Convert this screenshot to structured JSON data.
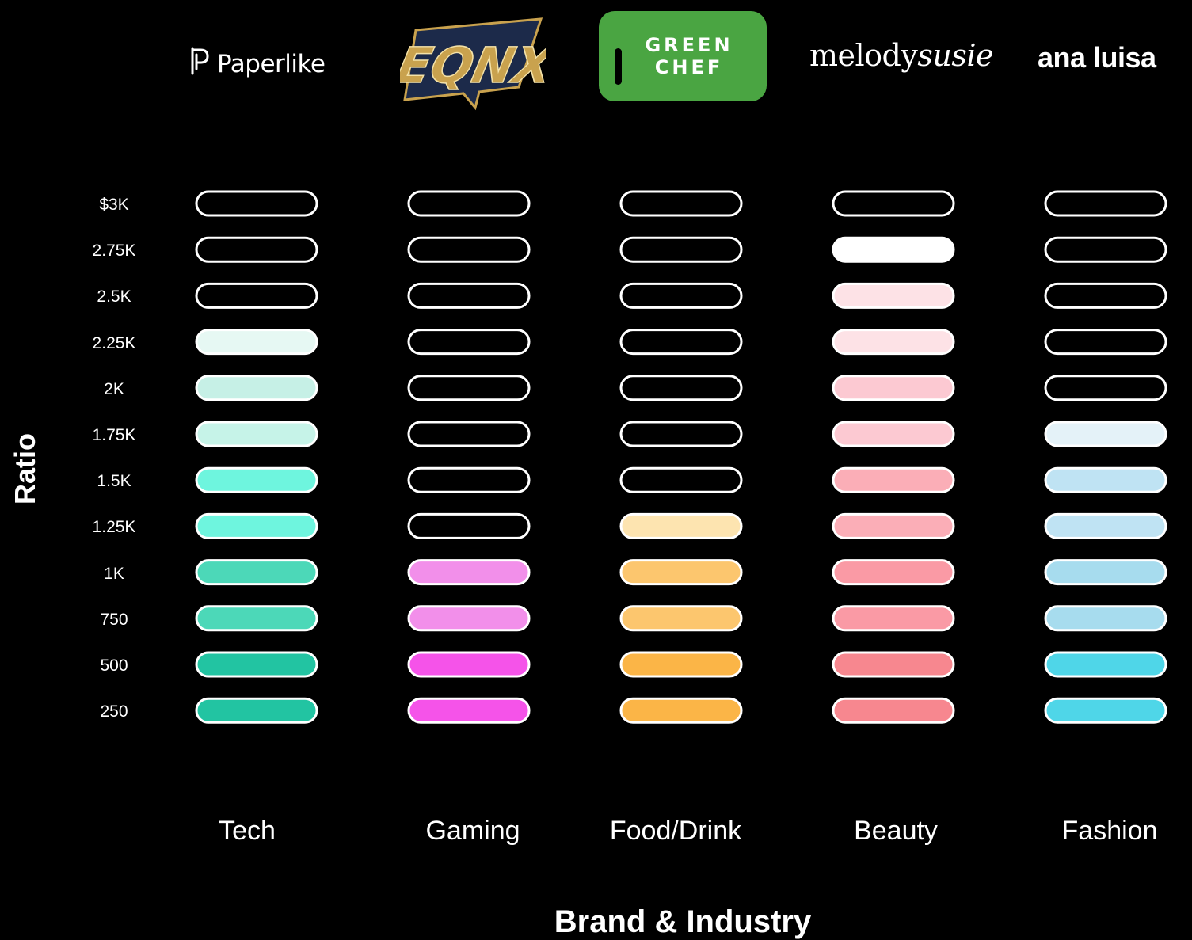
{
  "chart_data": {
    "type": "heatmap",
    "ylabel": "Ratio",
    "xlabel": "Brand & Industry",
    "y_ticks": [
      "$3K",
      "2.75K",
      "2.5K",
      "2.25K",
      "2K",
      "1.75K",
      "1.5K",
      "1.25K",
      "1K",
      "750",
      "500",
      "250"
    ],
    "categories": [
      "Tech",
      "Gaming",
      "Food/Drink",
      "Beauty",
      "Fashion"
    ],
    "brands": [
      "Paperlike",
      "EQNX",
      "GREEN CHEF",
      "melodysusie",
      "ana luisa"
    ],
    "series": [
      {
        "category": "Tech",
        "brand": "Paperlike",
        "filled_levels": 9,
        "colors": [
          "#e6f8f3",
          "#c6f0e6",
          "#c6f3e8",
          "#6ef5de",
          "#6ef5de",
          "#4cd8b8",
          "#4cd8b8",
          "#22c4a2",
          "#22c4a2"
        ]
      },
      {
        "category": "Gaming",
        "brand": "EQNX",
        "filled_levels": 4,
        "colors": [
          "#f28fea",
          "#f28fea",
          "#f553e9",
          "#f553e9"
        ]
      },
      {
        "category": "Food/Drink",
        "brand": "GREEN CHEF",
        "filled_levels": 5,
        "colors": [
          "#fde4b0",
          "#fcc66e",
          "#fcc66e",
          "#fbb547",
          "#fbb547"
        ]
      },
      {
        "category": "Beauty",
        "brand": "melodysusie",
        "filled_levels": 11,
        "colors": [
          "#ffffff",
          "#fde2e6",
          "#fde2e6",
          "#fcc9d2",
          "#fcc9d2",
          "#fbaeb7",
          "#fbaeb7",
          "#fa9aa5",
          "#fa9aa5",
          "#f7878f",
          "#f7878f"
        ]
      },
      {
        "category": "Fashion",
        "brand": "ana luisa",
        "filled_levels": 7,
        "colors": [
          "#e4f2f8",
          "#bfe3f3",
          "#bfe3f3",
          "#a7dcee",
          "#a7dcee",
          "#4fd6e8",
          "#4fd6e8"
        ]
      }
    ]
  },
  "logos": {
    "paperlike": "Paperlike",
    "eqnx": "EQNX",
    "greenchef_line1": "GREEN",
    "greenchef_line2": "CHEF",
    "melody_regular": "melody",
    "melody_italic": "susie",
    "analuisa": "ana luisa"
  },
  "colors": {
    "background": "#000000",
    "outline": "#ffffff",
    "greenchef_bg": "#4aa542",
    "eqnx_gold": "#c9a24e",
    "eqnx_navy": "#1c2a4a"
  }
}
